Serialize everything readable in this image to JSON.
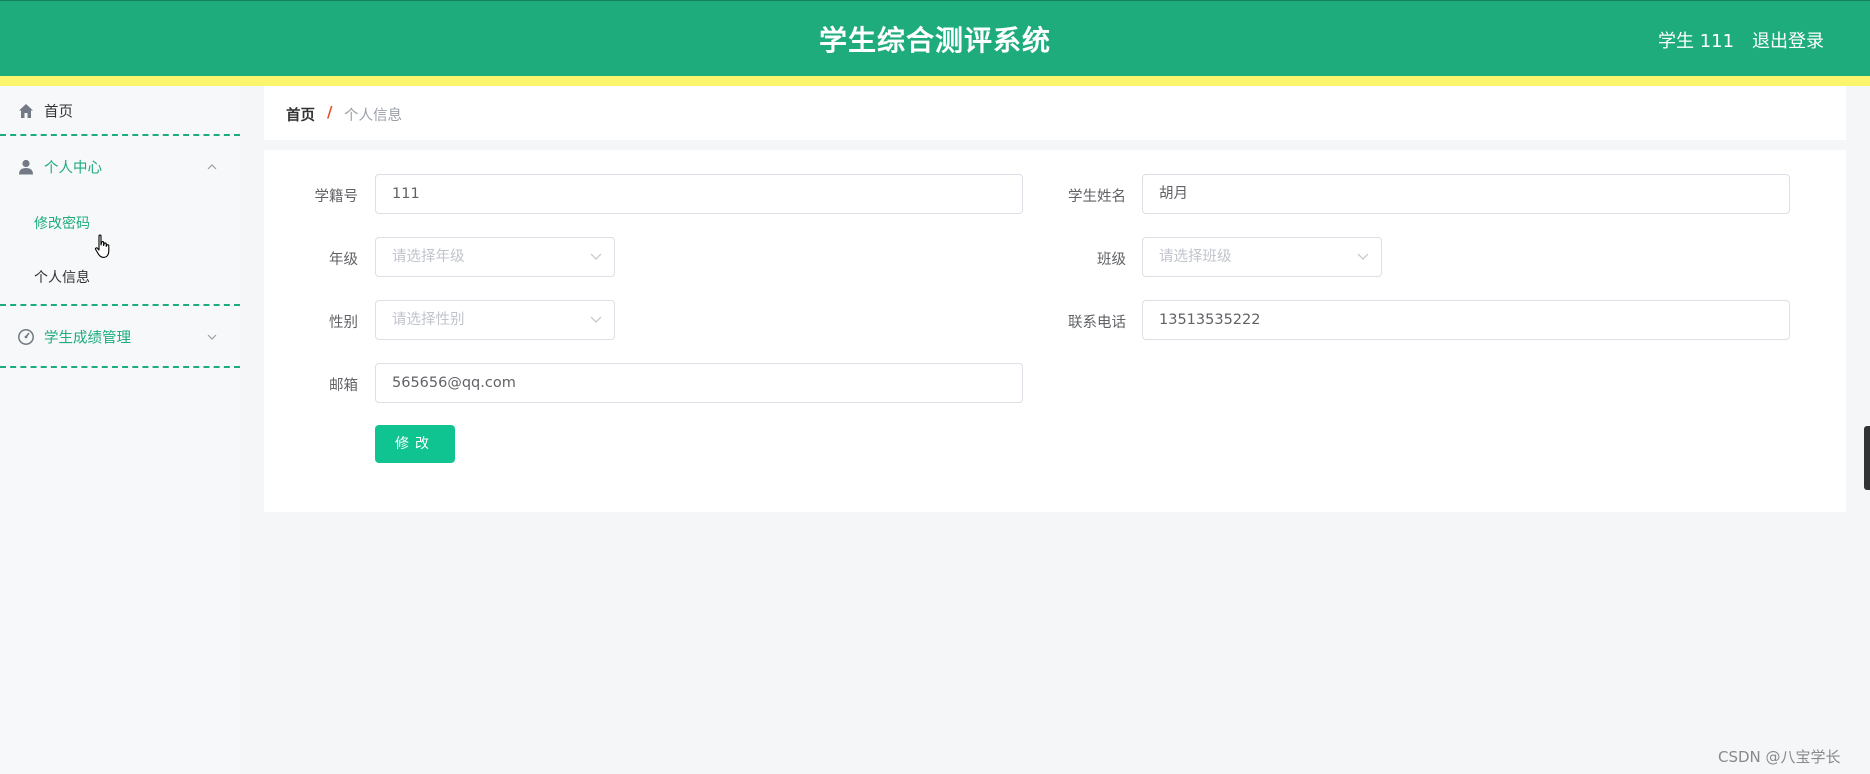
{
  "header": {
    "title": "学生综合测评系统",
    "user_label": "学生 111",
    "logout_label": "退出登录"
  },
  "sidebar": {
    "home_label": "首页",
    "personal_center": {
      "label": "个人中心",
      "items": [
        "修改密码",
        "个人信息"
      ]
    },
    "grades_label": "学生成绩管理"
  },
  "breadcrumb": {
    "home": "首页",
    "separator": "/",
    "current": "个人信息"
  },
  "form": {
    "student_id": {
      "label": "学籍号",
      "value": "111"
    },
    "student_name": {
      "label": "学生姓名",
      "value": "胡月"
    },
    "grade": {
      "label": "年级",
      "placeholder": "请选择年级"
    },
    "class": {
      "label": "班级",
      "placeholder": "请选择班级"
    },
    "gender": {
      "label": "性别",
      "placeholder": "请选择性别"
    },
    "phone": {
      "label": "联系电话",
      "value": "13513535222"
    },
    "email": {
      "label": "邮箱",
      "value": "565656@qq.com"
    },
    "submit_label": "修改"
  },
  "watermark": "CSDN @八宝学长",
  "colors": {
    "brand": "#1fac7c",
    "accent_strip": "#fbf46d",
    "button": "#0fc490",
    "breadcrumb_separator": "#e2502b"
  }
}
